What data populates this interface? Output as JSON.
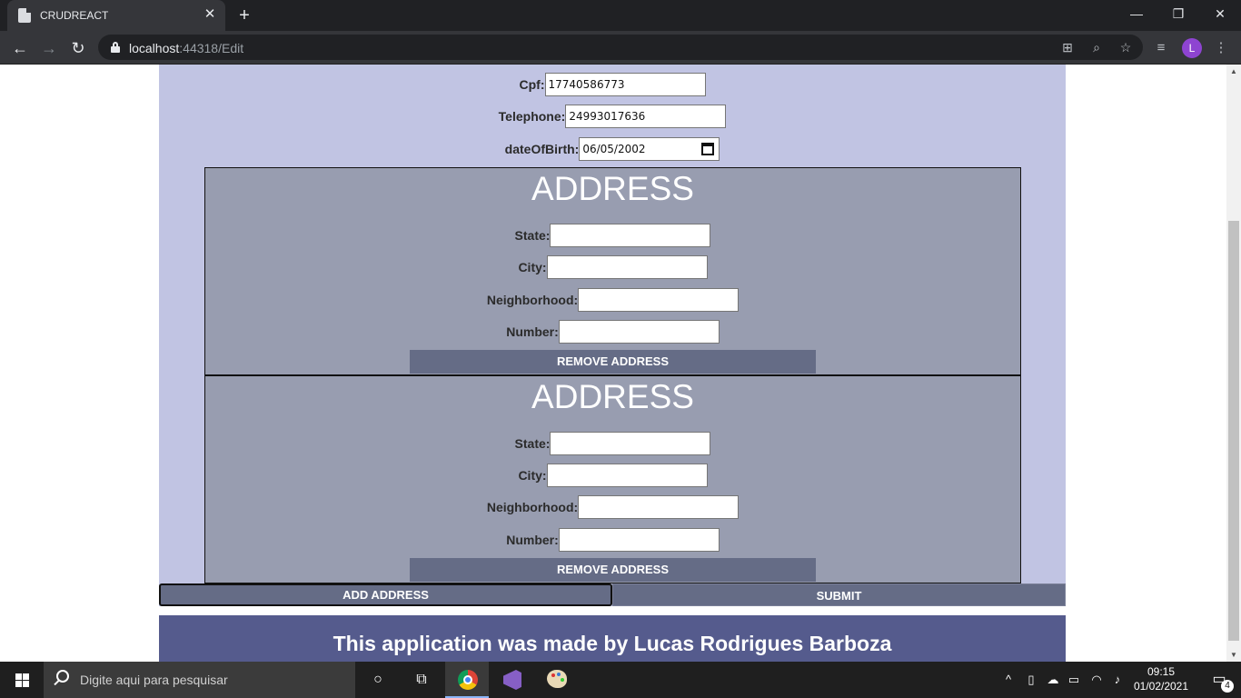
{
  "browser": {
    "tab_title": "CRUDREACT",
    "tab_close": "✕",
    "new_tab": "+",
    "url_host": "localhost",
    "url_rest": ":44318/Edit",
    "profile_initial": "L",
    "window_buttons": {
      "minimize": "—",
      "restore": "❐",
      "close": "✕"
    }
  },
  "form": {
    "cpf_label": "Cpf:",
    "cpf_value": "17740586773",
    "telephone_label": "Telephone:",
    "telephone_value": "24993017636",
    "dob_label": "dateOfBirth:",
    "dob_value": "06/05/2002"
  },
  "addresses": [
    {
      "title": "ADDRESS",
      "state_label": "State:",
      "state_value": "",
      "city_label": "City:",
      "city_value": "",
      "neighborhood_label": "Neighborhood:",
      "neighborhood_value": "",
      "number_label": "Number:",
      "number_value": "",
      "remove_label": "REMOVE ADDRESS"
    },
    {
      "title": "ADDRESS",
      "state_label": "State:",
      "state_value": "",
      "city_label": "City:",
      "city_value": "",
      "neighborhood_label": "Neighborhood:",
      "neighborhood_value": "",
      "number_label": "Number:",
      "number_value": "",
      "remove_label": "REMOVE ADDRESS"
    }
  ],
  "actions": {
    "add_address_label": "ADD ADDRESS",
    "submit_label": "SUBMIT"
  },
  "footer": {
    "text": "This application was made by Lucas Rodrigues Barboza"
  },
  "taskbar": {
    "search_placeholder": "Digite aqui para pesquisar",
    "time": "09:15",
    "date": "01/02/2021",
    "notification_count": "4"
  },
  "colors": {
    "page_panel": "#c1c4e3",
    "address_box": "#989db0",
    "button": "#656c86",
    "footer": "#555b8d"
  }
}
